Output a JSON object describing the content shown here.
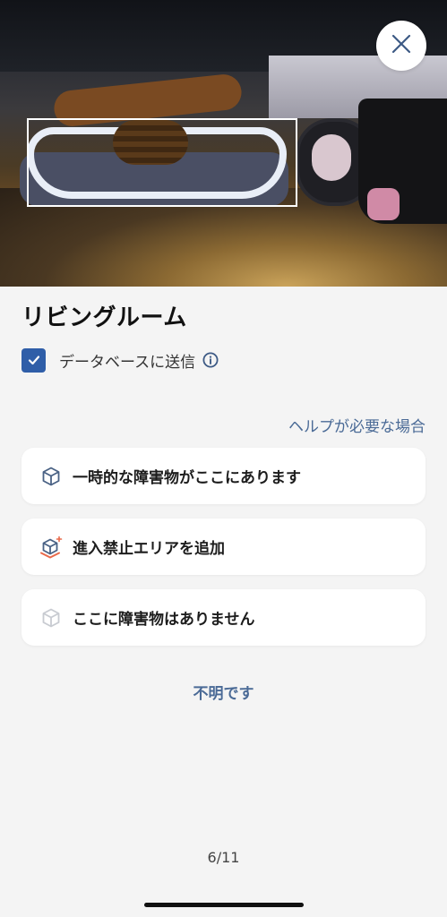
{
  "room": {
    "title": "リビングルーム"
  },
  "send_to_database": {
    "label": "データベースに送信",
    "checked": true
  },
  "help_link": "ヘルプが必要な場合",
  "options": [
    {
      "label": "一時的な障害物がここにあります",
      "icon": "box-icon"
    },
    {
      "label": "進入禁止エリアを追加",
      "icon": "no-go-zone-box-icon"
    },
    {
      "label": "ここに障害物はありません",
      "icon": "box-outline-faded-icon"
    }
  ],
  "unknown_link": "不明です",
  "pagination": {
    "text": "6/11"
  },
  "colors": {
    "accent": "#2f5ea8",
    "link": "#4a6a96",
    "background": "#f4f4f4",
    "card": "#ffffff",
    "no_go_orange": "#e8694a"
  }
}
